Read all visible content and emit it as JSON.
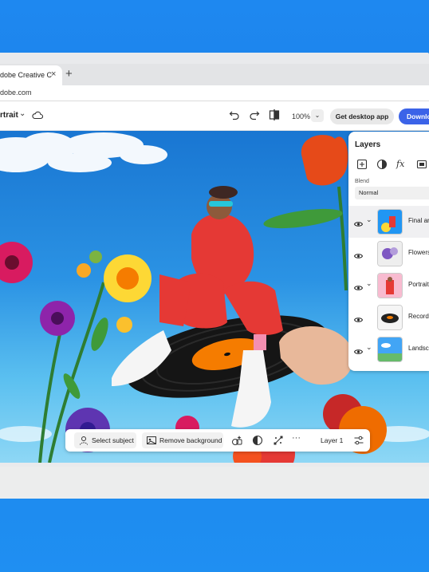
{
  "browser": {
    "tab_title": "dobe Creative C",
    "tab_close": "×",
    "new_tab": "+",
    "url": "dobe.com"
  },
  "app_header": {
    "doc_title": "rtrait",
    "doc_chevron": "⌄",
    "zoom_level": "100%",
    "zoom_dropdown": "⌄",
    "get_desktop_label": "Get desktop app",
    "download_label": "Downlo"
  },
  "layers_panel": {
    "title": "Layers",
    "tools": [
      "add-layer-icon",
      "mask-icon",
      "fx-icon",
      "frame-icon"
    ],
    "blend_label": "Blend",
    "blend_value": "Normal",
    "layers": [
      {
        "name": "Final ar",
        "expand": true,
        "selected": true
      },
      {
        "name": "Flowers",
        "expand": false,
        "selected": false
      },
      {
        "name": "Portrait",
        "expand": true,
        "selected": false
      },
      {
        "name": "Record",
        "expand": false,
        "selected": false
      },
      {
        "name": "Landsc",
        "expand": true,
        "selected": false
      }
    ]
  },
  "toolbar": {
    "select_subject": "Select subject",
    "remove_background": "Remove background",
    "more": "···",
    "layer_label": "Layer 1"
  },
  "colors": {
    "background_blue": "#1e88f0",
    "download_button": "#3b63e8",
    "sky": "#2b93e4"
  }
}
